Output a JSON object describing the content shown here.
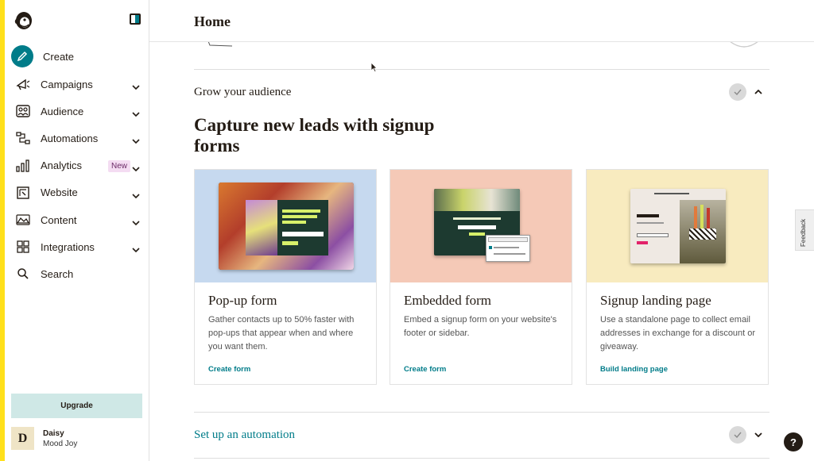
{
  "app": {
    "accent": "#007c89",
    "brand_yellow": "#ffe01b"
  },
  "sidebar": {
    "logo": "freddie-logo",
    "collapse_icon": "sidebar-toggle-icon",
    "create_label": "Create",
    "items": [
      {
        "label": "Campaigns",
        "icon": "megaphone-icon"
      },
      {
        "label": "Audience",
        "icon": "audience-icon"
      },
      {
        "label": "Automations",
        "icon": "automations-icon"
      },
      {
        "label": "Analytics",
        "icon": "bar-chart-icon",
        "badge": "New"
      },
      {
        "label": "Website",
        "icon": "website-icon"
      },
      {
        "label": "Content",
        "icon": "content-icon"
      },
      {
        "label": "Integrations",
        "icon": "grid-icon"
      },
      {
        "label": "Search",
        "icon": "search-icon"
      }
    ],
    "upgrade_label": "Upgrade",
    "user": {
      "initial": "D",
      "name": "Daisy",
      "org": "Mood Joy"
    }
  },
  "header": {
    "title": "Home"
  },
  "sections": {
    "grow": {
      "title": "Grow your audience",
      "headline": "Capture new leads with signup forms",
      "cards": [
        {
          "title": "Pop-up form",
          "desc": "Gather contacts up to 50% faster with pop-ups that appear when and where you want them.",
          "link": "Create form",
          "bg": "#c6d9ef"
        },
        {
          "title": "Embedded form",
          "desc": "Embed a signup form on your website's footer or sidebar.",
          "link": "Create form",
          "bg": "#f5c9b7"
        },
        {
          "title": "Signup landing page",
          "desc": "Use a standalone page to collect email addresses in exchange for a discount or giveaway.",
          "link": "Build landing page",
          "bg": "#f8ebbf"
        }
      ]
    },
    "automation": {
      "title": "Set up an automation"
    }
  },
  "widgets": {
    "feedback_label": "Feedback",
    "help_label": "?"
  }
}
